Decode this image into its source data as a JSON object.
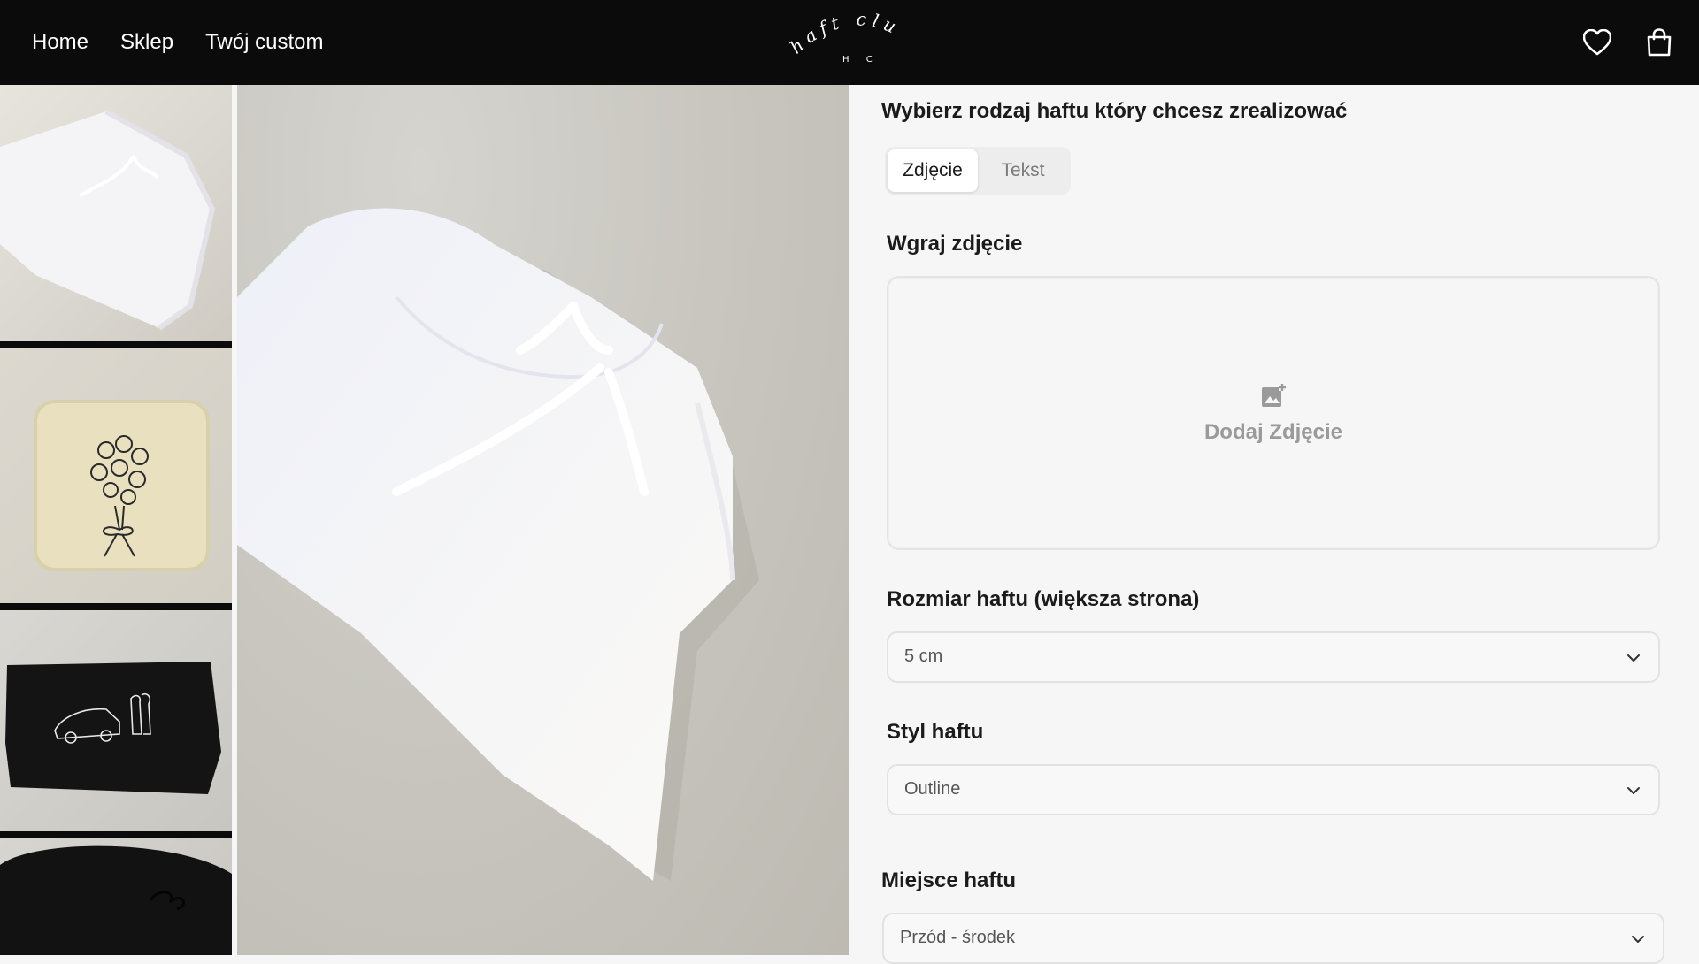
{
  "nav": {
    "items": [
      "Home",
      "Sklep",
      "Twój custom"
    ]
  },
  "logo": {
    "text_top": "haft club",
    "text_bottom": "H C"
  },
  "header_icons": [
    "heart-icon",
    "shopping-bag-icon"
  ],
  "gallery": {
    "thumbnails": [
      {
        "desc_name": "white-hoodie-thumb"
      },
      {
        "desc_name": "beige-hoodie-bouquet-thumb"
      },
      {
        "desc_name": "black-hoodie-car-thumb"
      },
      {
        "desc_name": "black-hoodie-thumb"
      }
    ]
  },
  "form": {
    "question": "Wybierz rodzaj haftu który chcesz zrealizować",
    "tabs": [
      "Zdjęcie",
      "Tekst"
    ],
    "active_tab": "Zdjęcie",
    "upload": {
      "label": "Wgraj zdjęcie",
      "button": "Dodaj Zdjęcie"
    },
    "size": {
      "label": "Rozmiar haftu (większa strona)",
      "value": "5 cm"
    },
    "style": {
      "label": "Styl haftu",
      "value": "Outline"
    },
    "place": {
      "label": "Miejsce haftu",
      "value": "Przód - środek"
    }
  },
  "colors": {
    "header_bg": "#0b0b0b",
    "panel_bg": "#f6f6f6",
    "muted": "#9a9a9a"
  }
}
